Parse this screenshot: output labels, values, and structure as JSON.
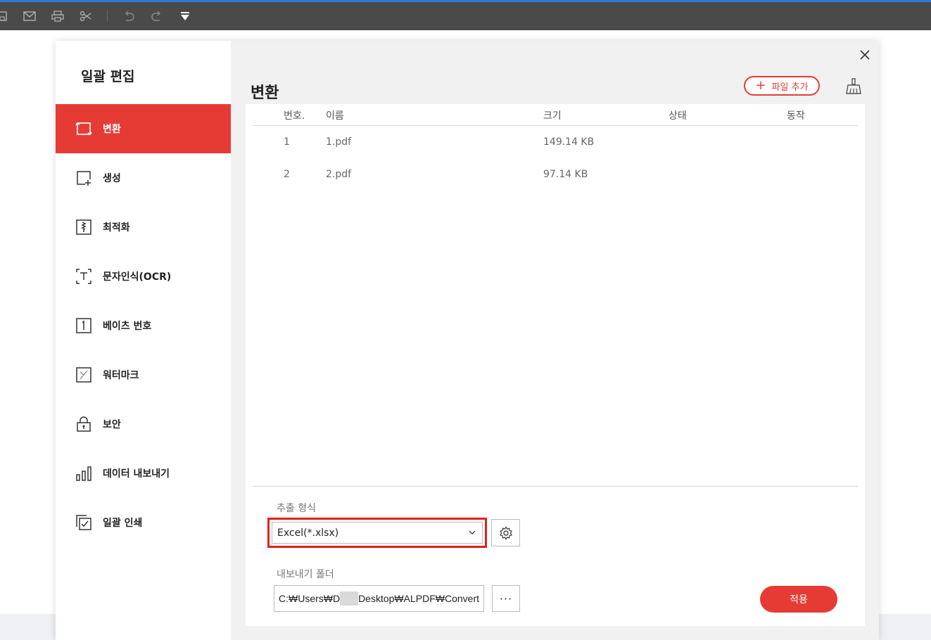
{
  "dialog": {
    "sidebar_title": "일괄 편집",
    "main_title": "변환",
    "add_file_label": "파일 추가",
    "sidebar_items": [
      {
        "label": "변환",
        "icon": "convert-icon",
        "active": true
      },
      {
        "label": "생성",
        "icon": "create-icon",
        "active": false
      },
      {
        "label": "최적화",
        "icon": "optimize-icon",
        "active": false
      },
      {
        "label": "문자인식(OCR)",
        "icon": "ocr-icon",
        "active": false
      },
      {
        "label": "베이츠 번호",
        "icon": "bates-number-icon",
        "active": false
      },
      {
        "label": "워터마크",
        "icon": "watermark-icon",
        "active": false
      },
      {
        "label": "보안",
        "icon": "lock-icon",
        "active": false
      },
      {
        "label": "데이터 내보내기",
        "icon": "data-export-icon",
        "active": false
      },
      {
        "label": "일괄 인쇄",
        "icon": "batch-print-icon",
        "active": false
      }
    ]
  },
  "table": {
    "headers": {
      "no": "번호.",
      "name": "이름",
      "size": "크기",
      "status": "상태",
      "action": "동작"
    },
    "rows": [
      {
        "no": "1",
        "name": "1.pdf",
        "size": "149.14 KB",
        "status": "",
        "action": ""
      },
      {
        "no": "2",
        "name": "2.pdf",
        "size": "97.14 KB",
        "status": "",
        "action": ""
      }
    ]
  },
  "form": {
    "format_label": "추출 형식",
    "format_value": "Excel(*.xlsx)",
    "folder_label": "내보내기 폴더",
    "folder_path_start": "C:₩Users₩D",
    "folder_path_end": "Desktop₩ALPDF₩Convert",
    "more_label": "···",
    "apply_label": "적용"
  },
  "colors": {
    "accent": "#e63b35",
    "highlight_box": "#e41f1f",
    "toolbar": "#4a4a4a"
  }
}
